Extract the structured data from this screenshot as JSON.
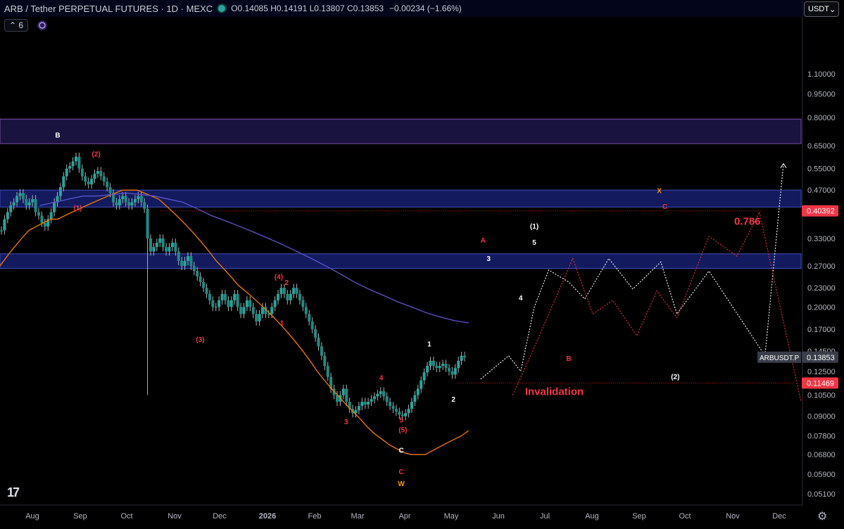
{
  "header": {
    "symbol": "ARB / Tether PERPETUAL FUTURES · 1D · MEXC",
    "ohlc": "O0.14085 H0.14191 L0.13807 C0.13853",
    "change": "−0.00234 (−1.66%)",
    "indicator_count": "6",
    "currency": "USDT"
  },
  "colors": {
    "bg": "#000000",
    "up": "#26a69a",
    "down": "#26a69a",
    "wick": "#a8b3b2",
    "zone_fill": "#1a237e",
    "zone_border": "#3f4fb5",
    "top_zone_fill": "#1c1546",
    "ma_fast": "#f57c00",
    "ma_slow": "#5e55c9",
    "accent_red": "#f23645",
    "white": "#ffffff",
    "orange": "#ff9800"
  },
  "chart_data": {
    "type": "candlestick",
    "y_scale": "log",
    "ylim": [
      0.047,
      1.6
    ],
    "y_ticks": [
      "1.10000",
      "0.95000",
      "0.80000",
      "0.65000",
      "0.55000",
      "0.47000",
      "0.33000",
      "0.27000",
      "0.23000",
      "0.20000",
      "0.17000",
      "0.14500",
      "0.12500",
      "0.10500",
      "0.09000",
      "0.07800",
      "0.06800",
      "0.05900",
      "0.05100"
    ],
    "x_ticks": [
      "Aug",
      "Sep",
      "Oct",
      "Nov",
      "Dec",
      "2026",
      "Feb",
      "Mar",
      "Apr",
      "May",
      "Jun",
      "Jul",
      "Aug",
      "Sep",
      "Oct",
      "Nov",
      "Dec"
    ],
    "zones": [
      {
        "from": 0.66,
        "to": 0.79,
        "kind": "top"
      },
      {
        "from": 0.415,
        "to": 0.47,
        "kind": "mid"
      },
      {
        "from": 0.265,
        "to": 0.295,
        "kind": "mid"
      }
    ],
    "price_labels": [
      {
        "value": 0.40392,
        "text": "0.40392",
        "style": "red"
      },
      {
        "value": 0.13853,
        "text": "0.13853",
        "tag": "ARBUSDT.P",
        "style": "gray"
      },
      {
        "value": 0.11469,
        "text": "0.11469",
        "style": "red"
      }
    ],
    "levels": [
      {
        "value": 0.40392,
        "from": 0.2,
        "to": 0.95
      },
      {
        "value": 0.11469,
        "from": 0.57,
        "to": 0.99
      }
    ],
    "series": [
      {
        "name": "",
        "values": [
          0.35,
          0.38,
          0.4,
          0.42,
          0.43,
          0.45,
          0.46,
          0.44,
          0.42,
          0.43,
          0.44,
          0.4,
          0.39,
          0.37,
          0.36,
          0.38,
          0.4,
          0.43,
          0.45,
          0.48,
          0.52,
          0.55,
          0.56,
          0.58,
          0.6,
          0.55,
          0.52,
          0.5,
          0.49,
          0.51,
          0.53,
          0.54,
          0.52,
          0.5,
          0.48,
          0.46,
          0.43,
          0.42,
          0.44,
          0.45,
          0.43,
          0.42,
          0.43,
          0.44,
          0.45,
          0.43,
          0.41,
          0.33,
          0.3,
          0.31,
          0.32,
          0.33,
          0.31,
          0.3,
          0.31,
          0.32,
          0.3,
          0.28,
          0.27,
          0.28,
          0.29,
          0.27,
          0.26,
          0.25,
          0.24,
          0.23,
          0.22,
          0.21,
          0.2,
          0.2,
          0.21,
          0.22,
          0.21,
          0.2,
          0.21,
          0.22,
          0.2,
          0.19,
          0.2,
          0.21,
          0.2,
          0.19,
          0.18,
          0.19,
          0.2,
          0.19,
          0.19,
          0.2,
          0.21,
          0.22,
          0.23,
          0.22,
          0.21,
          0.22,
          0.23,
          0.22,
          0.21,
          0.2,
          0.19,
          0.18,
          0.17,
          0.16,
          0.15,
          0.14,
          0.13,
          0.12,
          0.11,
          0.105,
          0.1,
          0.105,
          0.11,
          0.1,
          0.095,
          0.092,
          0.094,
          0.097,
          0.1,
          0.098,
          0.1,
          0.102,
          0.104,
          0.106,
          0.108,
          0.104,
          0.1,
          0.097,
          0.095,
          0.093,
          0.091,
          0.09,
          0.092,
          0.095,
          0.1,
          0.105,
          0.11,
          0.117,
          0.124,
          0.13,
          0.135,
          0.13,
          0.128,
          0.13,
          0.132,
          0.128,
          0.125,
          0.122,
          0.128,
          0.135,
          0.14,
          0.1385
        ]
      },
      {
        "name": "",
        "values": [
          0.27,
          0.29,
          0.31,
          0.33,
          0.35,
          0.36,
          0.37,
          0.38,
          0.38,
          0.39,
          0.4,
          0.41,
          0.42,
          0.43,
          0.44,
          0.45,
          0.46,
          0.47,
          0.47,
          0.47,
          0.46,
          0.45,
          0.44,
          0.42,
          0.4,
          0.38,
          0.36,
          0.34,
          0.32,
          0.3,
          0.28,
          0.265,
          0.25,
          0.235,
          0.225,
          0.215,
          0.205,
          0.195,
          0.185,
          0.175,
          0.165,
          0.155,
          0.145,
          0.135,
          0.125,
          0.117,
          0.11,
          0.104,
          0.098,
          0.093,
          0.088,
          0.083,
          0.079,
          0.076,
          0.073,
          0.071,
          0.069,
          0.068,
          0.068,
          0.068,
          0.07,
          0.072,
          0.074,
          0.076,
          0.078,
          0.081
        ]
      },
      {
        "name": "",
        "values": [
          0.42,
          0.43,
          0.44,
          0.45,
          0.45,
          0.455,
          0.46,
          0.455,
          0.45,
          0.44,
          0.43,
          0.41,
          0.39,
          0.375,
          0.36,
          0.345,
          0.33,
          0.315,
          0.3,
          0.285,
          0.27,
          0.255,
          0.24,
          0.228,
          0.218,
          0.208,
          0.2,
          0.192,
          0.186,
          0.181,
          0.178
        ]
      }
    ],
    "projections": [
      {
        "name": "",
        "color": "#ffffff",
        "points": [
          [
            0.6,
            0.118
          ],
          [
            0.635,
            0.14
          ],
          [
            0.65,
            0.125
          ],
          [
            0.667,
            0.2
          ],
          [
            0.685,
            0.262
          ],
          [
            0.71,
            0.24
          ],
          [
            0.73,
            0.212
          ],
          [
            0.76,
            0.285
          ],
          [
            0.79,
            0.228
          ],
          [
            0.825,
            0.278
          ],
          [
            0.845,
            0.19
          ],
          [
            0.885,
            0.26
          ],
          [
            0.955,
            0.14
          ],
          [
            0.978,
            0.57
          ]
        ]
      },
      {
        "name": "",
        "color": "#e53935",
        "points": [
          [
            0.64,
            0.105
          ],
          [
            0.665,
            0.145
          ],
          [
            0.715,
            0.285
          ],
          [
            0.74,
            0.19
          ],
          [
            0.765,
            0.21
          ],
          [
            0.795,
            0.162
          ],
          [
            0.82,
            0.225
          ],
          [
            0.845,
            0.185
          ],
          [
            0.885,
            0.335
          ],
          [
            0.92,
            0.29
          ],
          [
            0.948,
            0.4
          ],
          [
            1.0,
            0.1
          ]
        ]
      }
    ],
    "annotations": [
      {
        "text": "B",
        "x": 0.072,
        "y": 0.69,
        "color": "white"
      },
      {
        "text": "(2)",
        "x": 0.12,
        "y": 0.6,
        "color": "red"
      },
      {
        "text": "(1)",
        "x": 0.097,
        "y": 0.405,
        "color": "red"
      },
      {
        "text": "(3)",
        "x": 0.25,
        "y": 0.155,
        "color": "red"
      },
      {
        "text": "(4)",
        "x": 0.348,
        "y": 0.245,
        "color": "red"
      },
      {
        "text": "2",
        "x": 0.358,
        "y": 0.235,
        "color": "red"
      },
      {
        "text": "1",
        "x": 0.352,
        "y": 0.175,
        "color": "red"
      },
      {
        "text": "3",
        "x": 0.432,
        "y": 0.085,
        "color": "red"
      },
      {
        "text": "4",
        "x": 0.476,
        "y": 0.117,
        "color": "red"
      },
      {
        "text": "5",
        "x": 0.501,
        "y": 0.086,
        "color": "red"
      },
      {
        "text": "(5)",
        "x": 0.503,
        "y": 0.08,
        "color": "red"
      },
      {
        "text": "C",
        "x": 0.501,
        "y": 0.069,
        "color": "white"
      },
      {
        "text": "C",
        "x": 0.501,
        "y": 0.059,
        "color": "red"
      },
      {
        "text": "W",
        "x": 0.501,
        "y": 0.054,
        "color": "orange"
      },
      {
        "text": "1",
        "x": 0.536,
        "y": 0.15,
        "color": "white"
      },
      {
        "text": "2",
        "x": 0.566,
        "y": 0.1,
        "color": "white"
      },
      {
        "text": "3",
        "x": 0.61,
        "y": 0.28,
        "color": "white"
      },
      {
        "text": "4",
        "x": 0.65,
        "y": 0.21,
        "color": "white"
      },
      {
        "text": "5",
        "x": 0.667,
        "y": 0.315,
        "color": "white"
      },
      {
        "text": "(1)",
        "x": 0.667,
        "y": 0.355,
        "color": "white"
      },
      {
        "text": "A",
        "x": 0.603,
        "y": 0.32,
        "color": "red"
      },
      {
        "text": "B",
        "x": 0.71,
        "y": 0.135,
        "color": "red"
      },
      {
        "text": "X",
        "x": 0.823,
        "y": 0.46,
        "color": "orange"
      },
      {
        "text": "C",
        "x": 0.83,
        "y": 0.41,
        "color": "red"
      },
      {
        "text": "(2)",
        "x": 0.843,
        "y": 0.118,
        "color": "white"
      },
      {
        "text": "0.786",
        "x": 0.933,
        "y": 0.365,
        "color": "red",
        "size": "big"
      },
      {
        "text": "Invalidation",
        "x": 0.692,
        "y": 0.105,
        "color": "red",
        "size": "big"
      }
    ]
  }
}
